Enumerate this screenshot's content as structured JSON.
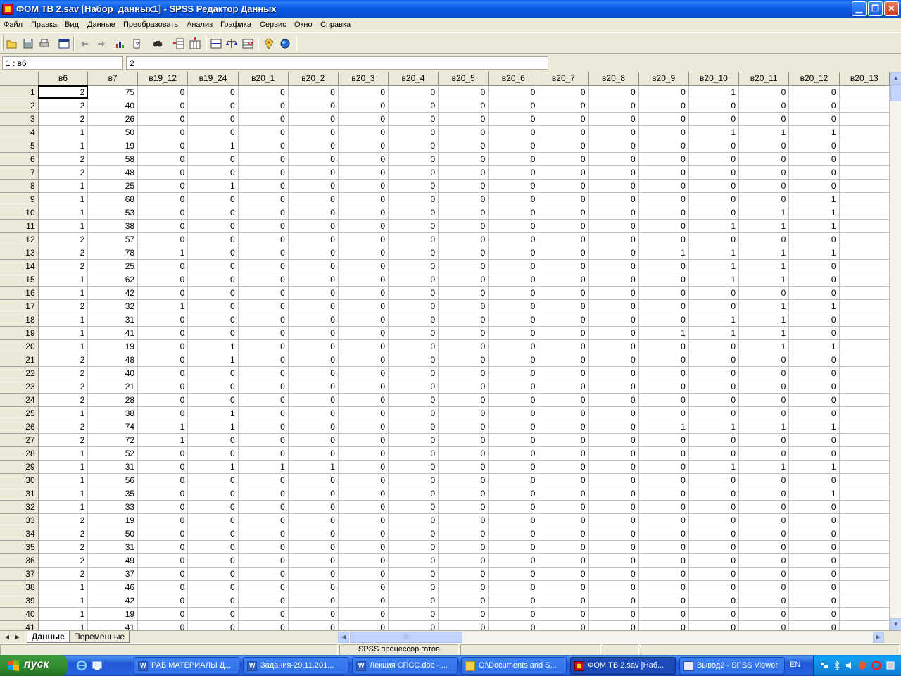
{
  "window": {
    "title": "ФОМ ТВ 2.sav [Набор_данных1] - SPSS Редактор Данных",
    "min_label": "▁",
    "max_label": "❐",
    "close_label": "✕"
  },
  "menu": [
    "Файл",
    "Правка",
    "Вид",
    "Данные",
    "Преобразовать",
    "Анализ",
    "Графика",
    "Сервис",
    "Окно",
    "Справка"
  ],
  "toolbar_icons": [
    "open-icon",
    "save-icon",
    "print-icon",
    "dialog-recall-icon",
    "undo-icon",
    "redo-icon",
    "goto-chart-icon",
    "goto-case-icon",
    "find-icon",
    "insert-case-icon",
    "insert-variable-icon",
    "split-file-icon",
    "weight-cases-icon",
    "select-cases-icon",
    "value-labels-icon",
    "use-sets-icon"
  ],
  "cell_editor": {
    "reference": "1 : в6",
    "value": "2"
  },
  "columns": [
    "в6",
    "в7",
    "в19_12",
    "в19_24",
    "в20_1",
    "в20_2",
    "в20_3",
    "в20_4",
    "в20_5",
    "в20_6",
    "в20_7",
    "в20_8",
    "в20_9",
    "в20_10",
    "в20_11",
    "в20_12",
    "в20_13"
  ],
  "rows": [
    [
      "1",
      "2",
      "75",
      "0",
      "0",
      "0",
      "0",
      "0",
      "0",
      "0",
      "0",
      "0",
      "0",
      "0",
      "1",
      "0",
      "0",
      ""
    ],
    [
      "2",
      "2",
      "40",
      "0",
      "0",
      "0",
      "0",
      "0",
      "0",
      "0",
      "0",
      "0",
      "0",
      "0",
      "0",
      "0",
      "0",
      ""
    ],
    [
      "3",
      "2",
      "26",
      "0",
      "0",
      "0",
      "0",
      "0",
      "0",
      "0",
      "0",
      "0",
      "0",
      "0",
      "0",
      "0",
      "0",
      ""
    ],
    [
      "4",
      "1",
      "50",
      "0",
      "0",
      "0",
      "0",
      "0",
      "0",
      "0",
      "0",
      "0",
      "0",
      "0",
      "1",
      "1",
      "1",
      ""
    ],
    [
      "5",
      "1",
      "19",
      "0",
      "1",
      "0",
      "0",
      "0",
      "0",
      "0",
      "0",
      "0",
      "0",
      "0",
      "0",
      "0",
      "0",
      ""
    ],
    [
      "6",
      "2",
      "58",
      "0",
      "0",
      "0",
      "0",
      "0",
      "0",
      "0",
      "0",
      "0",
      "0",
      "0",
      "0",
      "0",
      "0",
      ""
    ],
    [
      "7",
      "2",
      "48",
      "0",
      "0",
      "0",
      "0",
      "0",
      "0",
      "0",
      "0",
      "0",
      "0",
      "0",
      "0",
      "0",
      "0",
      ""
    ],
    [
      "8",
      "1",
      "25",
      "0",
      "1",
      "0",
      "0",
      "0",
      "0",
      "0",
      "0",
      "0",
      "0",
      "0",
      "0",
      "0",
      "0",
      ""
    ],
    [
      "9",
      "1",
      "68",
      "0",
      "0",
      "0",
      "0",
      "0",
      "0",
      "0",
      "0",
      "0",
      "0",
      "0",
      "0",
      "0",
      "1",
      ""
    ],
    [
      "10",
      "1",
      "53",
      "0",
      "0",
      "0",
      "0",
      "0",
      "0",
      "0",
      "0",
      "0",
      "0",
      "0",
      "0",
      "1",
      "1",
      ""
    ],
    [
      "11",
      "1",
      "38",
      "0",
      "0",
      "0",
      "0",
      "0",
      "0",
      "0",
      "0",
      "0",
      "0",
      "0",
      "1",
      "1",
      "1",
      ""
    ],
    [
      "12",
      "2",
      "57",
      "0",
      "0",
      "0",
      "0",
      "0",
      "0",
      "0",
      "0",
      "0",
      "0",
      "0",
      "0",
      "0",
      "0",
      ""
    ],
    [
      "13",
      "2",
      "78",
      "1",
      "0",
      "0",
      "0",
      "0",
      "0",
      "0",
      "0",
      "0",
      "0",
      "1",
      "1",
      "1",
      "1",
      ""
    ],
    [
      "14",
      "2",
      "25",
      "0",
      "0",
      "0",
      "0",
      "0",
      "0",
      "0",
      "0",
      "0",
      "0",
      "0",
      "1",
      "1",
      "0",
      ""
    ],
    [
      "15",
      "1",
      "62",
      "0",
      "0",
      "0",
      "0",
      "0",
      "0",
      "0",
      "0",
      "0",
      "0",
      "0",
      "1",
      "1",
      "0",
      ""
    ],
    [
      "16",
      "1",
      "42",
      "0",
      "0",
      "0",
      "0",
      "0",
      "0",
      "0",
      "0",
      "0",
      "0",
      "0",
      "0",
      "0",
      "0",
      ""
    ],
    [
      "17",
      "2",
      "32",
      "1",
      "0",
      "0",
      "0",
      "0",
      "0",
      "0",
      "0",
      "0",
      "0",
      "0",
      "0",
      "1",
      "1",
      ""
    ],
    [
      "18",
      "1",
      "31",
      "0",
      "0",
      "0",
      "0",
      "0",
      "0",
      "0",
      "0",
      "0",
      "0",
      "0",
      "1",
      "1",
      "0",
      ""
    ],
    [
      "19",
      "1",
      "41",
      "0",
      "0",
      "0",
      "0",
      "0",
      "0",
      "0",
      "0",
      "0",
      "0",
      "1",
      "1",
      "1",
      "0",
      ""
    ],
    [
      "20",
      "1",
      "19",
      "0",
      "1",
      "0",
      "0",
      "0",
      "0",
      "0",
      "0",
      "0",
      "0",
      "0",
      "0",
      "1",
      "1",
      ""
    ],
    [
      "21",
      "2",
      "48",
      "0",
      "1",
      "0",
      "0",
      "0",
      "0",
      "0",
      "0",
      "0",
      "0",
      "0",
      "0",
      "0",
      "0",
      ""
    ],
    [
      "22",
      "2",
      "40",
      "0",
      "0",
      "0",
      "0",
      "0",
      "0",
      "0",
      "0",
      "0",
      "0",
      "0",
      "0",
      "0",
      "0",
      ""
    ],
    [
      "23",
      "2",
      "21",
      "0",
      "0",
      "0",
      "0",
      "0",
      "0",
      "0",
      "0",
      "0",
      "0",
      "0",
      "0",
      "0",
      "0",
      ""
    ],
    [
      "24",
      "2",
      "28",
      "0",
      "0",
      "0",
      "0",
      "0",
      "0",
      "0",
      "0",
      "0",
      "0",
      "0",
      "0",
      "0",
      "0",
      ""
    ],
    [
      "25",
      "1",
      "38",
      "0",
      "1",
      "0",
      "0",
      "0",
      "0",
      "0",
      "0",
      "0",
      "0",
      "0",
      "0",
      "0",
      "0",
      ""
    ],
    [
      "26",
      "2",
      "74",
      "1",
      "1",
      "0",
      "0",
      "0",
      "0",
      "0",
      "0",
      "0",
      "0",
      "1",
      "1",
      "1",
      "1",
      ""
    ],
    [
      "27",
      "2",
      "72",
      "1",
      "0",
      "0",
      "0",
      "0",
      "0",
      "0",
      "0",
      "0",
      "0",
      "0",
      "0",
      "0",
      "0",
      ""
    ],
    [
      "28",
      "1",
      "52",
      "0",
      "0",
      "0",
      "0",
      "0",
      "0",
      "0",
      "0",
      "0",
      "0",
      "0",
      "0",
      "0",
      "0",
      ""
    ],
    [
      "29",
      "1",
      "31",
      "0",
      "1",
      "1",
      "1",
      "0",
      "0",
      "0",
      "0",
      "0",
      "0",
      "0",
      "1",
      "1",
      "1",
      ""
    ],
    [
      "30",
      "1",
      "56",
      "0",
      "0",
      "0",
      "0",
      "0",
      "0",
      "0",
      "0",
      "0",
      "0",
      "0",
      "0",
      "0",
      "0",
      ""
    ],
    [
      "31",
      "1",
      "35",
      "0",
      "0",
      "0",
      "0",
      "0",
      "0",
      "0",
      "0",
      "0",
      "0",
      "0",
      "0",
      "0",
      "1",
      ""
    ],
    [
      "32",
      "1",
      "33",
      "0",
      "0",
      "0",
      "0",
      "0",
      "0",
      "0",
      "0",
      "0",
      "0",
      "0",
      "0",
      "0",
      "0",
      ""
    ],
    [
      "33",
      "2",
      "19",
      "0",
      "0",
      "0",
      "0",
      "0",
      "0",
      "0",
      "0",
      "0",
      "0",
      "0",
      "0",
      "0",
      "0",
      ""
    ],
    [
      "34",
      "2",
      "50",
      "0",
      "0",
      "0",
      "0",
      "0",
      "0",
      "0",
      "0",
      "0",
      "0",
      "0",
      "0",
      "0",
      "0",
      ""
    ],
    [
      "35",
      "2",
      "31",
      "0",
      "0",
      "0",
      "0",
      "0",
      "0",
      "0",
      "0",
      "0",
      "0",
      "0",
      "0",
      "0",
      "0",
      ""
    ],
    [
      "36",
      "2",
      "49",
      "0",
      "0",
      "0",
      "0",
      "0",
      "0",
      "0",
      "0",
      "0",
      "0",
      "0",
      "0",
      "0",
      "0",
      ""
    ],
    [
      "37",
      "2",
      "37",
      "0",
      "0",
      "0",
      "0",
      "0",
      "0",
      "0",
      "0",
      "0",
      "0",
      "0",
      "0",
      "0",
      "0",
      ""
    ],
    [
      "38",
      "1",
      "46",
      "0",
      "0",
      "0",
      "0",
      "0",
      "0",
      "0",
      "0",
      "0",
      "0",
      "0",
      "0",
      "0",
      "0",
      ""
    ],
    [
      "39",
      "1",
      "42",
      "0",
      "0",
      "0",
      "0",
      "0",
      "0",
      "0",
      "0",
      "0",
      "0",
      "0",
      "0",
      "0",
      "0",
      ""
    ],
    [
      "40",
      "1",
      "19",
      "0",
      "0",
      "0",
      "0",
      "0",
      "0",
      "0",
      "0",
      "0",
      "0",
      "0",
      "0",
      "0",
      "0",
      ""
    ],
    [
      "41",
      "1",
      "41",
      "0",
      "0",
      "0",
      "0",
      "0",
      "0",
      "0",
      "0",
      "0",
      "0",
      "0",
      "0",
      "0",
      "0",
      ""
    ]
  ],
  "tabs": [
    "Данные",
    "Переменные"
  ],
  "status": "SPSS процессор готов",
  "taskbar": {
    "start_label": "пуск",
    "tasks": [
      {
        "label": "РАБ МАТЕРИАЛЫ Д...",
        "icon": "folder-icon"
      },
      {
        "label": "Задания-29.11.201...",
        "icon": "word-icon"
      },
      {
        "label": "Лекция СПСС.doc - ...",
        "icon": "word-icon"
      },
      {
        "label": "C:\\Documents and S...",
        "icon": "folder-icon"
      },
      {
        "label": "ФОМ ТВ 2.sav [Наб...",
        "icon": "spss-icon"
      },
      {
        "label": "Вывод2 - SPSS Viewer",
        "icon": "viewer-icon"
      }
    ],
    "language": "EN"
  }
}
